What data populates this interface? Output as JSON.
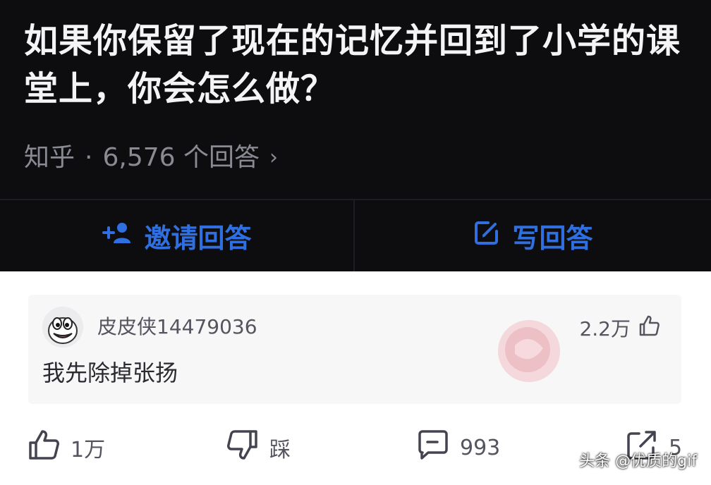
{
  "question": {
    "title": "如果你保留了现在的记忆并回到了小学的课堂上，你会怎么做？",
    "source": "知乎",
    "separator": "·",
    "answer_count": "6,576 个回答",
    "chevron": "›"
  },
  "actions": {
    "invite_label": "邀请回答",
    "invite_icon": "add-person-icon",
    "write_label": "写回答",
    "write_icon": "edit-icon",
    "accent": "#2f6fe0"
  },
  "comment": {
    "username": "皮皮侠14479036",
    "likes": "2.2万",
    "text": "我先除掉张扬"
  },
  "bottom_bar": {
    "like_count": "1万",
    "dislike_label": "踩",
    "comment_count": "993",
    "share_count": "5"
  },
  "watermark": "头条 @优质的gif"
}
